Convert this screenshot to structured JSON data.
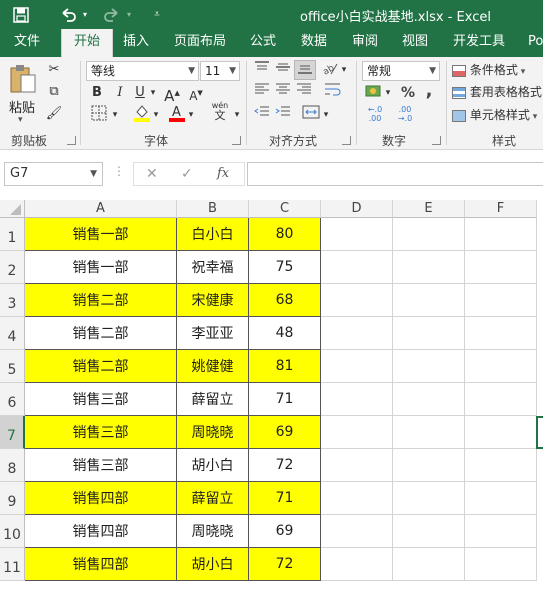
{
  "window": {
    "title": "office小白实战基地.xlsx - Excel",
    "save_icon": "save-icon",
    "undo_icon": "undo-icon",
    "redo_icon": "redo-icon",
    "customize_icon": "customize-qat-icon"
  },
  "tabs": [
    "文件",
    "开始",
    "插入",
    "页面布局",
    "公式",
    "数据",
    "审阅",
    "视图",
    "开发工具",
    "Po"
  ],
  "active_tab": "开始",
  "ribbon": {
    "clipboard": {
      "paste_label": "粘贴",
      "group_label": "剪贴板"
    },
    "font": {
      "name": "等线",
      "size": "11",
      "bold": "B",
      "italic": "I",
      "underline": "U",
      "fill_color": "#ffff00",
      "font_color": "#ff0000",
      "group_label": "字体",
      "wen": "wén"
    },
    "alignment": {
      "group_label": "对齐方式"
    },
    "number": {
      "format": "常规",
      "percent": "%",
      "comma": ",",
      "group_label": "数字"
    },
    "styles": {
      "conditional": "条件格式",
      "table": "套用表格格式",
      "cell_styles": "单元格样式",
      "group_label": "样式"
    }
  },
  "formula_bar": {
    "name_box": "G7",
    "cancel": "✕",
    "enter": "✓",
    "fx": "fx",
    "value": ""
  },
  "columns": [
    "A",
    "B",
    "C",
    "D",
    "E",
    "F"
  ],
  "rows": [
    {
      "num": "1",
      "dept": "销售一部",
      "name": "白小白",
      "score": "80",
      "highlight": true
    },
    {
      "num": "2",
      "dept": "销售一部",
      "name": "祝幸福",
      "score": "75",
      "highlight": false
    },
    {
      "num": "3",
      "dept": "销售二部",
      "name": "宋健康",
      "score": "68",
      "highlight": true
    },
    {
      "num": "4",
      "dept": "销售二部",
      "name": "李亚亚",
      "score": "48",
      "highlight": false
    },
    {
      "num": "5",
      "dept": "销售二部",
      "name": "姚健健",
      "score": "81",
      "highlight": true
    },
    {
      "num": "6",
      "dept": "销售三部",
      "name": "薛留立",
      "score": "71",
      "highlight": false
    },
    {
      "num": "7",
      "dept": "销售三部",
      "name": "周晓晓",
      "score": "69",
      "highlight": true
    },
    {
      "num": "8",
      "dept": "销售三部",
      "name": "胡小白",
      "score": "72",
      "highlight": false
    },
    {
      "num": "9",
      "dept": "销售四部",
      "name": "薛留立",
      "score": "71",
      "highlight": true
    },
    {
      "num": "10",
      "dept": "销售四部",
      "name": "周晓晓",
      "score": "69",
      "highlight": false
    },
    {
      "num": "11",
      "dept": "销售四部",
      "name": "胡小白",
      "score": "72",
      "highlight": true
    }
  ],
  "selected_row": "7",
  "highlight_color": "#ffff00",
  "accent_color": "#217346"
}
